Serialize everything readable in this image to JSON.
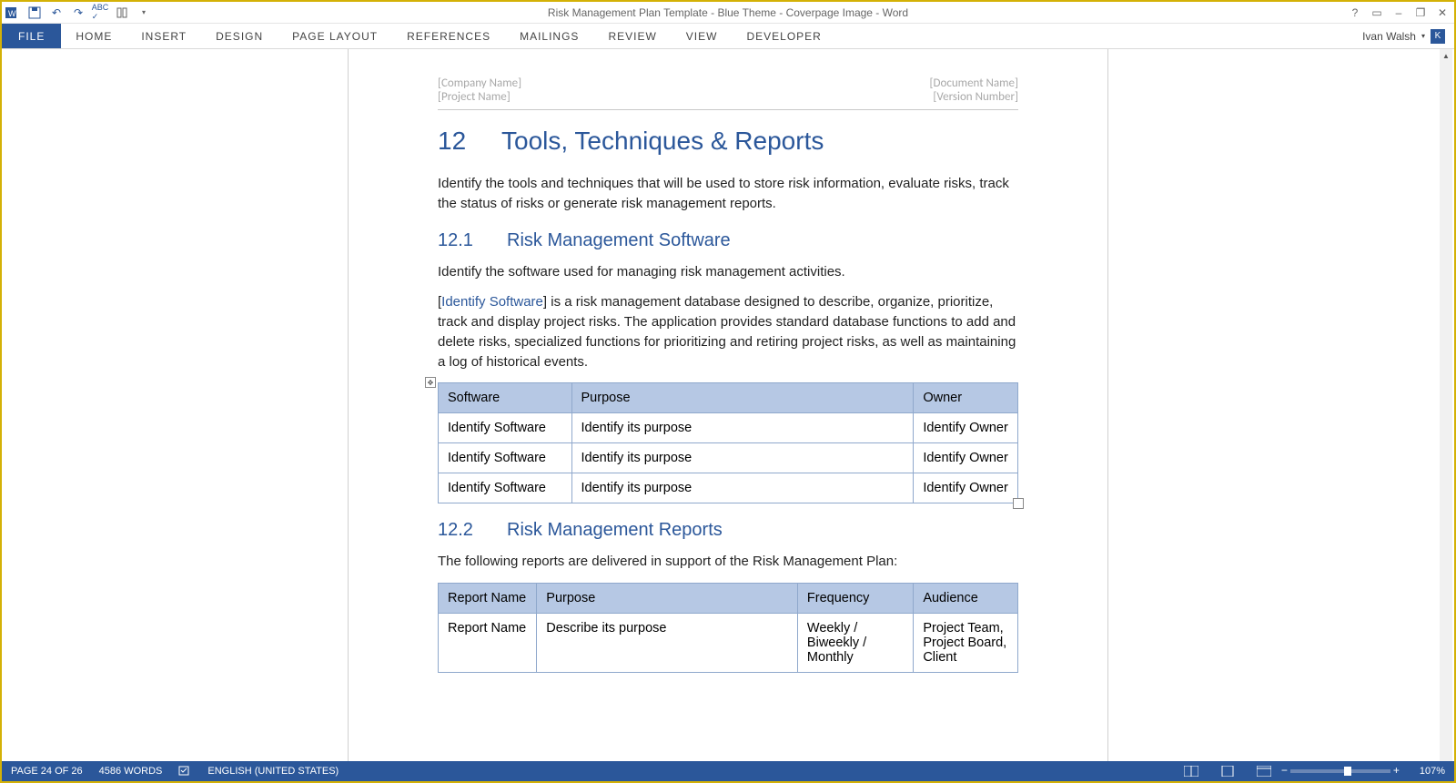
{
  "window": {
    "title": "Risk Management Plan Template - Blue Theme - Coverpage Image - Word"
  },
  "qat": {
    "icons": [
      "word",
      "save",
      "undo",
      "redo",
      "spelling",
      "touch"
    ]
  },
  "winControls": {
    "help": "?",
    "ribbonOptions": "▭",
    "minimize": "–",
    "restore": "❐",
    "close": "✕"
  },
  "ribbon": {
    "tabs": [
      "FILE",
      "HOME",
      "INSERT",
      "DESIGN",
      "PAGE LAYOUT",
      "REFERENCES",
      "MAILINGS",
      "REVIEW",
      "VIEW",
      "DEVELOPER"
    ],
    "user": "Ivan Walsh",
    "userInitial": "K"
  },
  "doc": {
    "header": {
      "company": "[Company Name]",
      "project": "[Project Name]",
      "docname": "[Document Name]",
      "version": "[Version Number]"
    },
    "h1_num": "12",
    "h1_title": "Tools, Techniques & Reports",
    "p1": "Identify the tools and techniques that will be used to store risk information, evaluate risks, track the status of risks or generate risk management reports.",
    "h2a_num": "12.1",
    "h2a_title": "Risk Management Software",
    "p2": "Identify the software used for managing risk management activities.",
    "p3_link": "Identify Software",
    "p3_rest": "] is a risk management database designed to describe, organize, prioritize, track and display project risks. The application provides standard database functions to add and delete risks, specialized functions for prioritizing and retiring project risks, as well as maintaining a log of historical events.",
    "table1": {
      "headers": [
        "Software",
        "Purpose",
        "Owner"
      ],
      "rows": [
        [
          "Identify Software",
          "Identify its purpose",
          "Identify Owner"
        ],
        [
          "Identify Software",
          "Identify its purpose",
          "Identify Owner"
        ],
        [
          "Identify Software",
          "Identify its purpose",
          "Identify Owner"
        ]
      ]
    },
    "h2b_num": "12.2",
    "h2b_title": "Risk Management Reports",
    "p4": "The following reports are delivered in support of the Risk Management Plan:",
    "table2": {
      "headers": [
        "Report Name",
        "Purpose",
        "Frequency",
        "Audience"
      ],
      "rows": [
        [
          "Report Name",
          "Describe its purpose",
          "Weekly / Biweekly / Monthly",
          "Project Team, Project Board, Client"
        ]
      ]
    }
  },
  "status": {
    "page": "PAGE 24 OF 26",
    "words": "4586 WORDS",
    "lang": "ENGLISH (UNITED STATES)",
    "zoom": "107%"
  }
}
